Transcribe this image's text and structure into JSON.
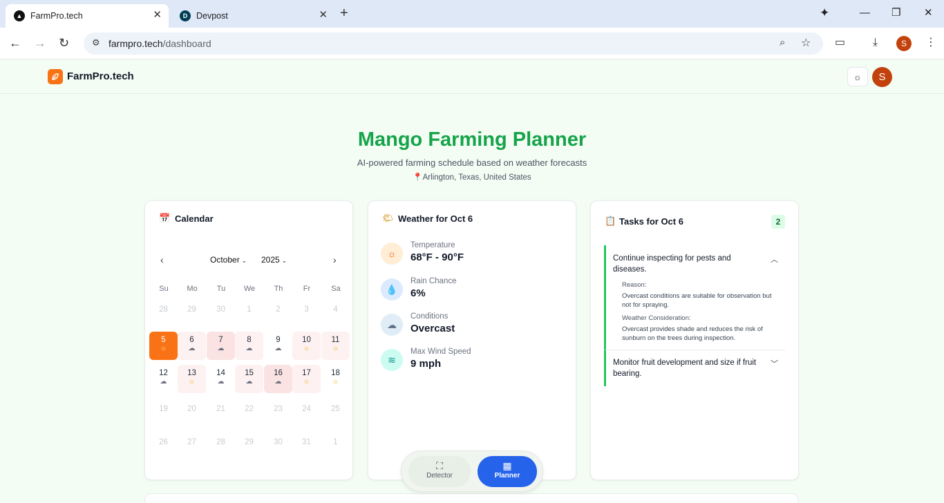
{
  "browser": {
    "tabs": [
      {
        "title": "FarmPro.tech",
        "active": true
      },
      {
        "title": "Devpost",
        "active": false
      }
    ],
    "url_host": "farmpro.tech",
    "url_path": "/dashboard",
    "profile_initial": "S"
  },
  "header": {
    "brand": "FarmPro.tech",
    "user_initial": "S"
  },
  "hero": {
    "title": "Mango Farming Planner",
    "subtitle": "AI-powered farming schedule based on weather forecasts",
    "location": "Arlington, Texas, United States"
  },
  "calendar": {
    "title": "Calendar",
    "month": "October",
    "year": "2025",
    "weekdays": [
      "Su",
      "Mo",
      "Tu",
      "We",
      "Th",
      "Fr",
      "Sa"
    ],
    "weeks": [
      [
        {
          "d": "28",
          "s": "muted"
        },
        {
          "d": "29",
          "s": "muted"
        },
        {
          "d": "30",
          "s": "muted"
        },
        {
          "d": "1",
          "s": "muted"
        },
        {
          "d": "2",
          "s": "muted"
        },
        {
          "d": "3",
          "s": "muted"
        },
        {
          "d": "4",
          "s": "muted"
        }
      ],
      [
        {
          "d": "5",
          "s": "sel",
          "i": "sun"
        },
        {
          "d": "6",
          "s": "pink",
          "i": "cloud"
        },
        {
          "d": "7",
          "s": "pink2",
          "i": "cloud"
        },
        {
          "d": "8",
          "s": "pink",
          "i": "cloud"
        },
        {
          "d": "9",
          "s": "cur",
          "i": "cloud"
        },
        {
          "d": "10",
          "s": "pink",
          "i": "sun"
        },
        {
          "d": "11",
          "s": "pink",
          "i": "sun"
        }
      ],
      [
        {
          "d": "12",
          "s": "cur",
          "i": "cloud"
        },
        {
          "d": "13",
          "s": "pink",
          "i": "sun"
        },
        {
          "d": "14",
          "s": "cur",
          "i": "cloud"
        },
        {
          "d": "15",
          "s": "pink",
          "i": "cloud"
        },
        {
          "d": "16",
          "s": "pink2",
          "i": "cloud"
        },
        {
          "d": "17",
          "s": "pink",
          "i": "sun"
        },
        {
          "d": "18",
          "s": "cur",
          "i": "sun"
        }
      ],
      [
        {
          "d": "19",
          "s": "muted"
        },
        {
          "d": "20",
          "s": "muted"
        },
        {
          "d": "21",
          "s": "muted"
        },
        {
          "d": "22",
          "s": "muted"
        },
        {
          "d": "23",
          "s": "muted"
        },
        {
          "d": "24",
          "s": "muted"
        },
        {
          "d": "25",
          "s": "muted"
        }
      ],
      [
        {
          "d": "26",
          "s": "muted"
        },
        {
          "d": "27",
          "s": "muted"
        },
        {
          "d": "28",
          "s": "muted"
        },
        {
          "d": "29",
          "s": "muted"
        },
        {
          "d": "30",
          "s": "muted"
        },
        {
          "d": "31",
          "s": "muted"
        },
        {
          "d": "1",
          "s": "muted"
        }
      ]
    ]
  },
  "weather": {
    "title": "Weather for Oct 6",
    "items": [
      {
        "label": "Temperature",
        "value": "68°F - 90°F",
        "icon": "sun-icon"
      },
      {
        "label": "Rain Chance",
        "value": "6%",
        "icon": "droplets-icon"
      },
      {
        "label": "Conditions",
        "value": "Overcast",
        "icon": "cloud-icon"
      },
      {
        "label": "Max Wind Speed",
        "value": "9 mph",
        "icon": "wind-icon"
      }
    ]
  },
  "tasks": {
    "title": "Tasks for Oct 6",
    "count": "2",
    "items": [
      {
        "title": "Continue inspecting for pests and diseases.",
        "reason_label": "Reason:",
        "reason": "Overcast conditions are suitable for observation but not for spraying.",
        "weather_label": "Weather Consideration:",
        "weather": "Overcast provides shade and reduces the risk of sunburn on the trees during inspection."
      },
      {
        "title": "Monitor fruit development and size if fruit bearing."
      }
    ]
  },
  "dock": {
    "detector": "Detector",
    "planner": "Planner"
  },
  "colors": {
    "accent_green": "#16a34a",
    "selected_day": "#f97316",
    "planner_button": "#2563eb"
  }
}
